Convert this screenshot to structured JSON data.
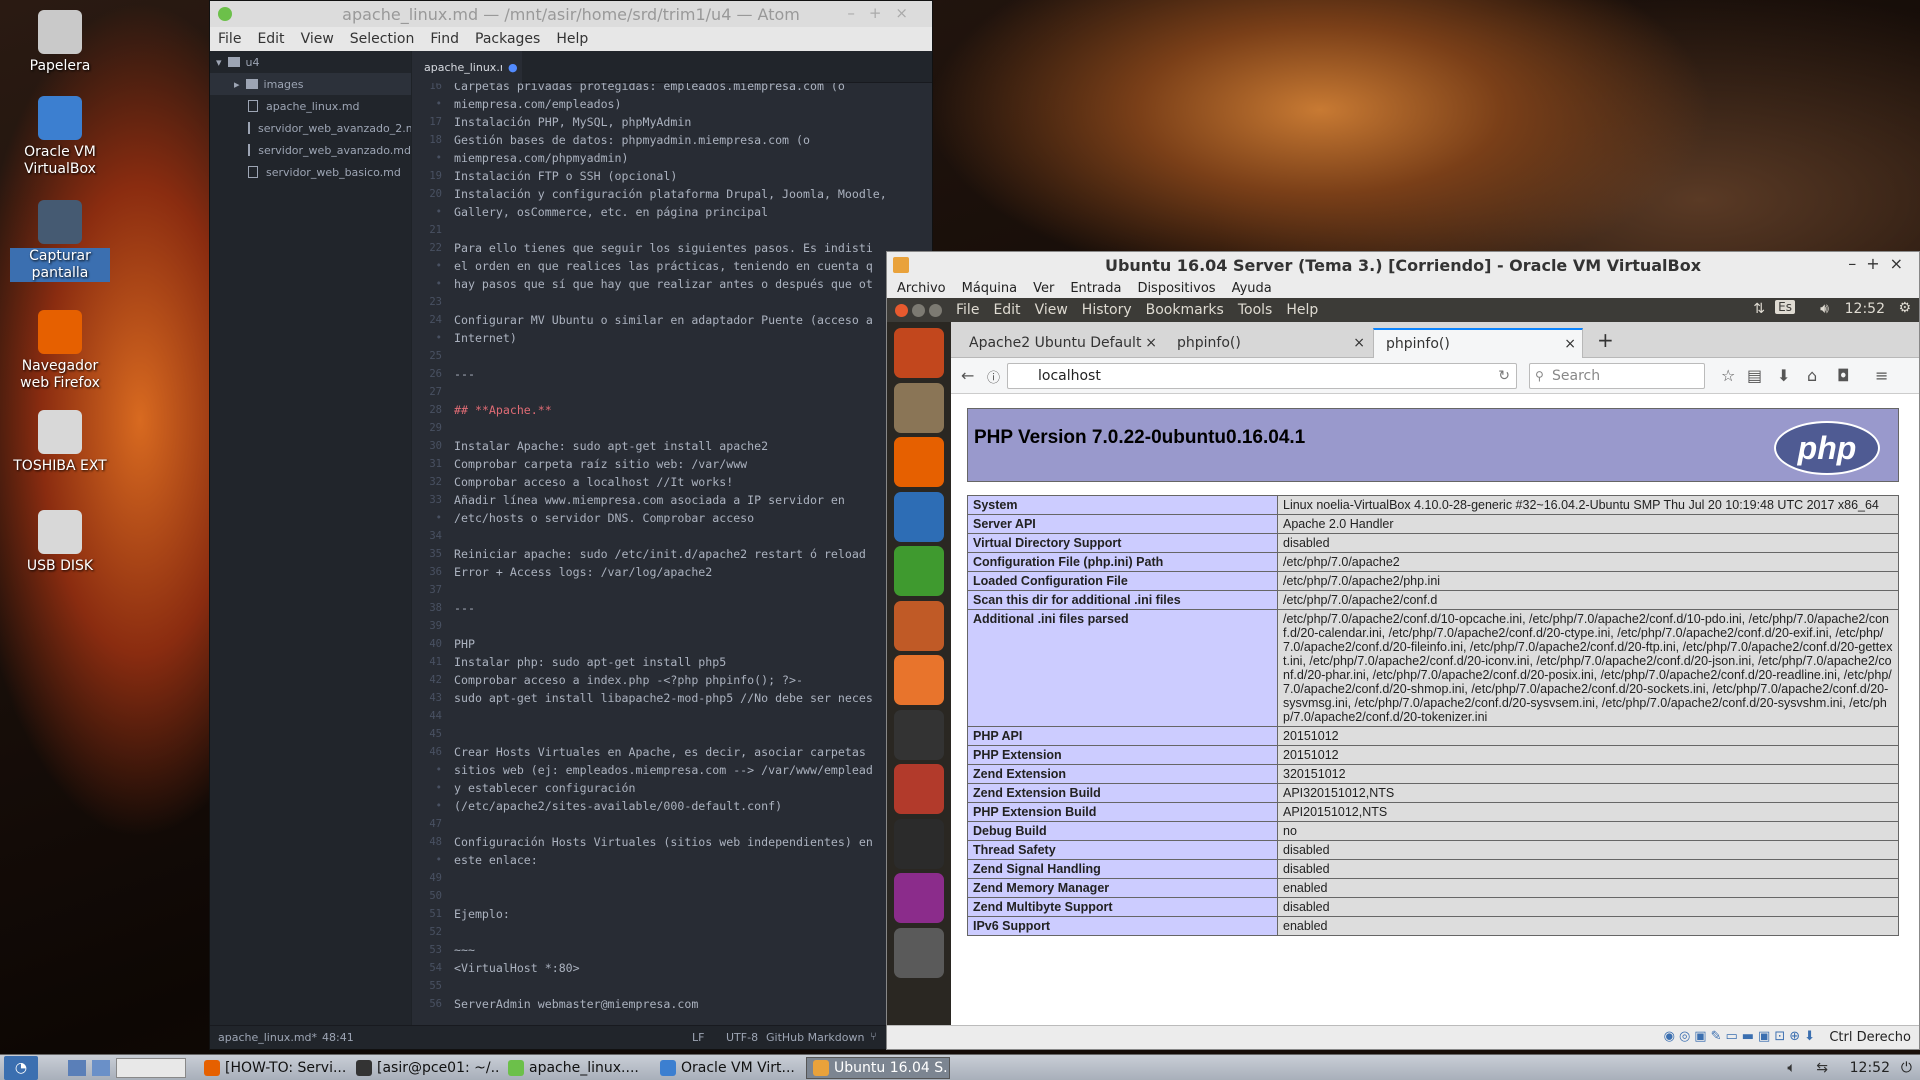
{
  "desktop": {
    "icons": [
      {
        "label": "Papelera",
        "color": "#c9c9c9"
      },
      {
        "label": "Oracle VM VirtualBox",
        "color": "#3c7fd0"
      },
      {
        "label": "Capturar pantalla",
        "color": "#455a72"
      },
      {
        "label": "Navegador web Firefox",
        "color": "#e66000"
      },
      {
        "label": "TOSHIBA EXT",
        "color": "#d8d8d8"
      },
      {
        "label": "USB DISK",
        "color": "#d8d8d8"
      }
    ]
  },
  "atom": {
    "title": "apache_linux.md — /mnt/asir/home/srd/trim1/u4 — Atom",
    "menu": [
      "File",
      "Edit",
      "View",
      "Selection",
      "Find",
      "Packages",
      "Help"
    ],
    "tree": {
      "root": "u4",
      "folder": "images",
      "files": [
        "apache_linux.md",
        "servidor_web_avanzado_2.md",
        "servidor_web_avanzado.md",
        "servidor_web_basico.md"
      ]
    },
    "tab": "apache_linux.md",
    "lines": [
      {
        "n": "16",
        "t": "Carpetas privadas protegidas: empleados.miempresa.com (o"
      },
      {
        "n": "•",
        "t": "miempresa.com/empleados)"
      },
      {
        "n": "17",
        "t": "Instalación PHP, MySQL, phpMyAdmin"
      },
      {
        "n": "18",
        "t": "Gestión bases de datos: phpmyadmin.miempresa.com (o"
      },
      {
        "n": "•",
        "t": "miempresa.com/phpmyadmin)"
      },
      {
        "n": "19",
        "t": "Instalación FTP o SSH (opcional)"
      },
      {
        "n": "20",
        "t": "Instalación y configuración plataforma Drupal, Joomla, Moodle,"
      },
      {
        "n": "•",
        "t": "Gallery, osCommerce, etc. en página principal"
      },
      {
        "n": "21",
        "t": ""
      },
      {
        "n": "22",
        "t": "Para ello tienes que seguir los siguientes pasos. Es indisti"
      },
      {
        "n": "•",
        "t": "el orden en que realices las prácticas, teniendo en cuenta q"
      },
      {
        "n": "•",
        "t": "hay pasos que sí que hay que realizar antes o después que ot"
      },
      {
        "n": "23",
        "t": ""
      },
      {
        "n": "24",
        "t": "Configurar MV Ubuntu o similar en adaptador Puente (acceso a"
      },
      {
        "n": "•",
        "t": "Internet)"
      },
      {
        "n": "25",
        "t": ""
      },
      {
        "n": "26",
        "t": "---"
      },
      {
        "n": "27",
        "t": ""
      },
      {
        "n": "28",
        "t": "## **Apache.**"
      },
      {
        "n": "29",
        "t": ""
      },
      {
        "n": "30",
        "t": "Instalar Apache: sudo apt-get install apache2"
      },
      {
        "n": "31",
        "t": "Comprobar carpeta raíz sitio web: /var/www"
      },
      {
        "n": "32",
        "t": "Comprobar acceso a localhost //It works!"
      },
      {
        "n": "33",
        "t": "Añadir línea www.miempresa.com asociada a IP servidor en"
      },
      {
        "n": "•",
        "t": "/etc/hosts o servidor DNS. Comprobar acceso"
      },
      {
        "n": "34",
        "t": ""
      },
      {
        "n": "35",
        "t": "Reiniciar apache: sudo /etc/init.d/apache2 restart ó reload"
      },
      {
        "n": "36",
        "t": "Error + Access logs: /var/log/apache2"
      },
      {
        "n": "37",
        "t": ""
      },
      {
        "n": "38",
        "t": "---"
      },
      {
        "n": "39",
        "t": ""
      },
      {
        "n": "40",
        "t": "PHP"
      },
      {
        "n": "41",
        "t": "Instalar php: sudo apt-get install php5"
      },
      {
        "n": "42",
        "t": "Comprobar acceso a index.php -<?php phpinfo(); ?>-"
      },
      {
        "n": "43",
        "t": "sudo apt-get install libapache2-mod-php5 //No debe ser neces"
      },
      {
        "n": "44",
        "t": ""
      },
      {
        "n": "45",
        "t": ""
      },
      {
        "n": "46",
        "t": "Crear Hosts Virtuales en Apache, es decir, asociar carpetas"
      },
      {
        "n": "•",
        "t": "sitios web (ej: empleados.miempresa.com --> /var/www/emplead"
      },
      {
        "n": "•",
        "t": "y establecer configuración"
      },
      {
        "n": "•",
        "t": "(/etc/apache2/sites-available/000-default.conf)"
      },
      {
        "n": "47",
        "t": ""
      },
      {
        "n": "48",
        "t": "Configuración Hosts Virtuales (sitios web independientes) en"
      },
      {
        "n": "•",
        "t": "este enlace:"
      },
      {
        "n": "49",
        "t": ""
      },
      {
        "n": "50",
        "t": ""
      },
      {
        "n": "51",
        "t": "Ejemplo:"
      },
      {
        "n": "52",
        "t": ""
      },
      {
        "n": "53",
        "t": "~~~"
      },
      {
        "n": "54",
        "t": "<VirtualHost *:80>"
      },
      {
        "n": "55",
        "t": ""
      },
      {
        "n": "56",
        "t": "ServerAdmin webmaster@miempresa.com"
      }
    ],
    "status": {
      "file": "apache_linux.md*",
      "pos": "48:41",
      "eol": "LF",
      "enc": "UTF-8",
      "grammar": "GitHub Markdown"
    }
  },
  "vbox": {
    "title": "Ubuntu 16.04 Server (Tema 3.) [Corriendo] - Oracle VM VirtualBox",
    "menu": [
      "Archivo",
      "Máquina",
      "Ver",
      "Entrada",
      "Dispositivos",
      "Ayuda"
    ],
    "host_key": "Ctrl Derecho"
  },
  "ubuntu": {
    "menu": [
      "File",
      "Edit",
      "View",
      "History",
      "Bookmarks",
      "Tools",
      "Help"
    ],
    "lang": "Es",
    "time": "12:52"
  },
  "firefox": {
    "tabs": [
      "Apache2 Ubuntu Default",
      "phpinfo()",
      "phpinfo()"
    ],
    "url": "localhost",
    "search_placeholder": "Search"
  },
  "phpinfo": {
    "version": "PHP Version 7.0.22-0ubuntu0.16.04.1",
    "logo": "php",
    "rows": [
      [
        "System",
        "Linux noelia-VirtualBox 4.10.0-28-generic #32~16.04.2-Ubuntu SMP Thu Jul 20 10:19:48 UTC 2017 x86_64"
      ],
      [
        "Server API",
        "Apache 2.0 Handler"
      ],
      [
        "Virtual Directory Support",
        "disabled"
      ],
      [
        "Configuration File (php.ini) Path",
        "/etc/php/7.0/apache2"
      ],
      [
        "Loaded Configuration File",
        "/etc/php/7.0/apache2/php.ini"
      ],
      [
        "Scan this dir for additional .ini files",
        "/etc/php/7.0/apache2/conf.d"
      ],
      [
        "Additional .ini files parsed",
        "/etc/php/7.0/apache2/conf.d/10-opcache.ini, /etc/php/7.0/apache2/conf.d/10-pdo.ini, /etc/php/7.0/apache2/conf.d/20-calendar.ini, /etc/php/7.0/apache2/conf.d/20-ctype.ini, /etc/php/7.0/apache2/conf.d/20-exif.ini, /etc/php/7.0/apache2/conf.d/20-fileinfo.ini, /etc/php/7.0/apache2/conf.d/20-ftp.ini, /etc/php/7.0/apache2/conf.d/20-gettext.ini, /etc/php/7.0/apache2/conf.d/20-iconv.ini, /etc/php/7.0/apache2/conf.d/20-json.ini, /etc/php/7.0/apache2/conf.d/20-phar.ini, /etc/php/7.0/apache2/conf.d/20-posix.ini, /etc/php/7.0/apache2/conf.d/20-readline.ini, /etc/php/7.0/apache2/conf.d/20-shmop.ini, /etc/php/7.0/apache2/conf.d/20-sockets.ini, /etc/php/7.0/apache2/conf.d/20-sysvmsg.ini, /etc/php/7.0/apache2/conf.d/20-sysvsem.ini, /etc/php/7.0/apache2/conf.d/20-sysvshm.ini, /etc/php/7.0/apache2/conf.d/20-tokenizer.ini"
      ],
      [
        "PHP API",
        "20151012"
      ],
      [
        "PHP Extension",
        "20151012"
      ],
      [
        "Zend Extension",
        "320151012"
      ],
      [
        "Zend Extension Build",
        "API320151012,NTS"
      ],
      [
        "PHP Extension Build",
        "API20151012,NTS"
      ],
      [
        "Debug Build",
        "no"
      ],
      [
        "Thread Safety",
        "disabled"
      ],
      [
        "Zend Signal Handling",
        "disabled"
      ],
      [
        "Zend Memory Manager",
        "enabled"
      ],
      [
        "Zend Multibyte Support",
        "disabled"
      ],
      [
        "IPv6 Support",
        "enabled"
      ]
    ]
  },
  "taskbar": {
    "items": [
      "[HOW-TO: Servi...",
      "[asir@pce01: ~/...",
      "apache_linux....",
      "Oracle VM Virt...",
      "Ubuntu 16.04 S..."
    ],
    "clock": "12:52"
  }
}
